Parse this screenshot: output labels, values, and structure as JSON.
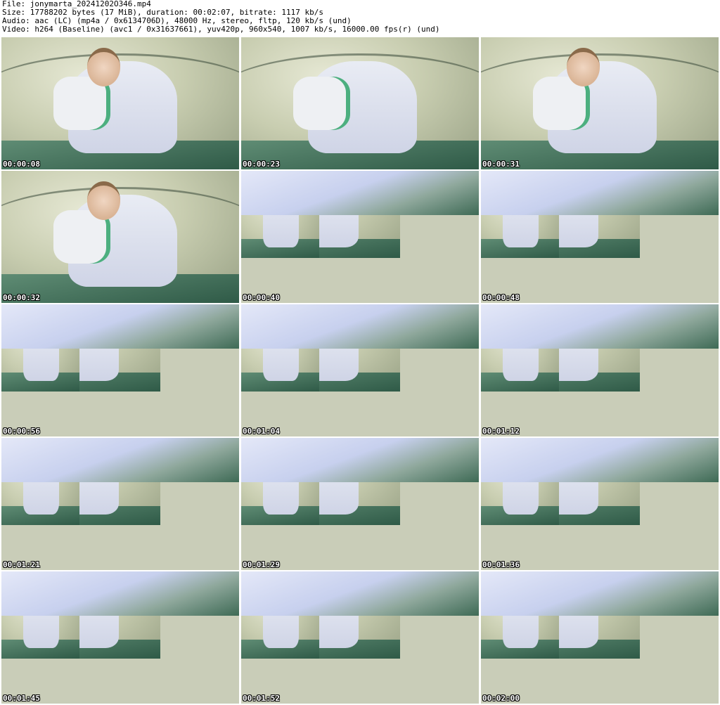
{
  "file_info": {
    "file": "File: jonymarta_20241202O346.mp4",
    "size": "Size: 17788202 bytes (17 MiB), duration: 00:02:07, bitrate: 1117 kb/s",
    "audio": "Audio: aac (LC) (mp4a / 0x6134706D), 48000 Hz, stereo, fltp, 120 kb/s (und)",
    "video": "Video: h264 (Baseline) (avc1 / 0x31637661), yuv420p, 960x540, 1007 kb/s, 16000.00 fps(r) (und)"
  },
  "thumbnails": [
    {
      "timestamp": "00:00:08"
    },
    {
      "timestamp": "00:00:23"
    },
    {
      "timestamp": "00:00:31"
    },
    {
      "timestamp": "00:00:32"
    },
    {
      "timestamp": "00:00:40"
    },
    {
      "timestamp": "00:00:48"
    },
    {
      "timestamp": "00:00:56"
    },
    {
      "timestamp": "00:01:04"
    },
    {
      "timestamp": "00:01:12"
    },
    {
      "timestamp": "00:01:21"
    },
    {
      "timestamp": "00:01:29"
    },
    {
      "timestamp": "00:01:36"
    },
    {
      "timestamp": "00:01:45"
    },
    {
      "timestamp": "00:01:52"
    },
    {
      "timestamp": "00:02:00"
    }
  ],
  "colors": {
    "background": "#ffffff",
    "text": "#000000",
    "timestamp_text": "#ffffff",
    "tent_wall": "#c8cdb0",
    "tent_floor": "#2f5a47",
    "clothing": "#e9ecf4",
    "accent_print": "#4caf7f"
  }
}
